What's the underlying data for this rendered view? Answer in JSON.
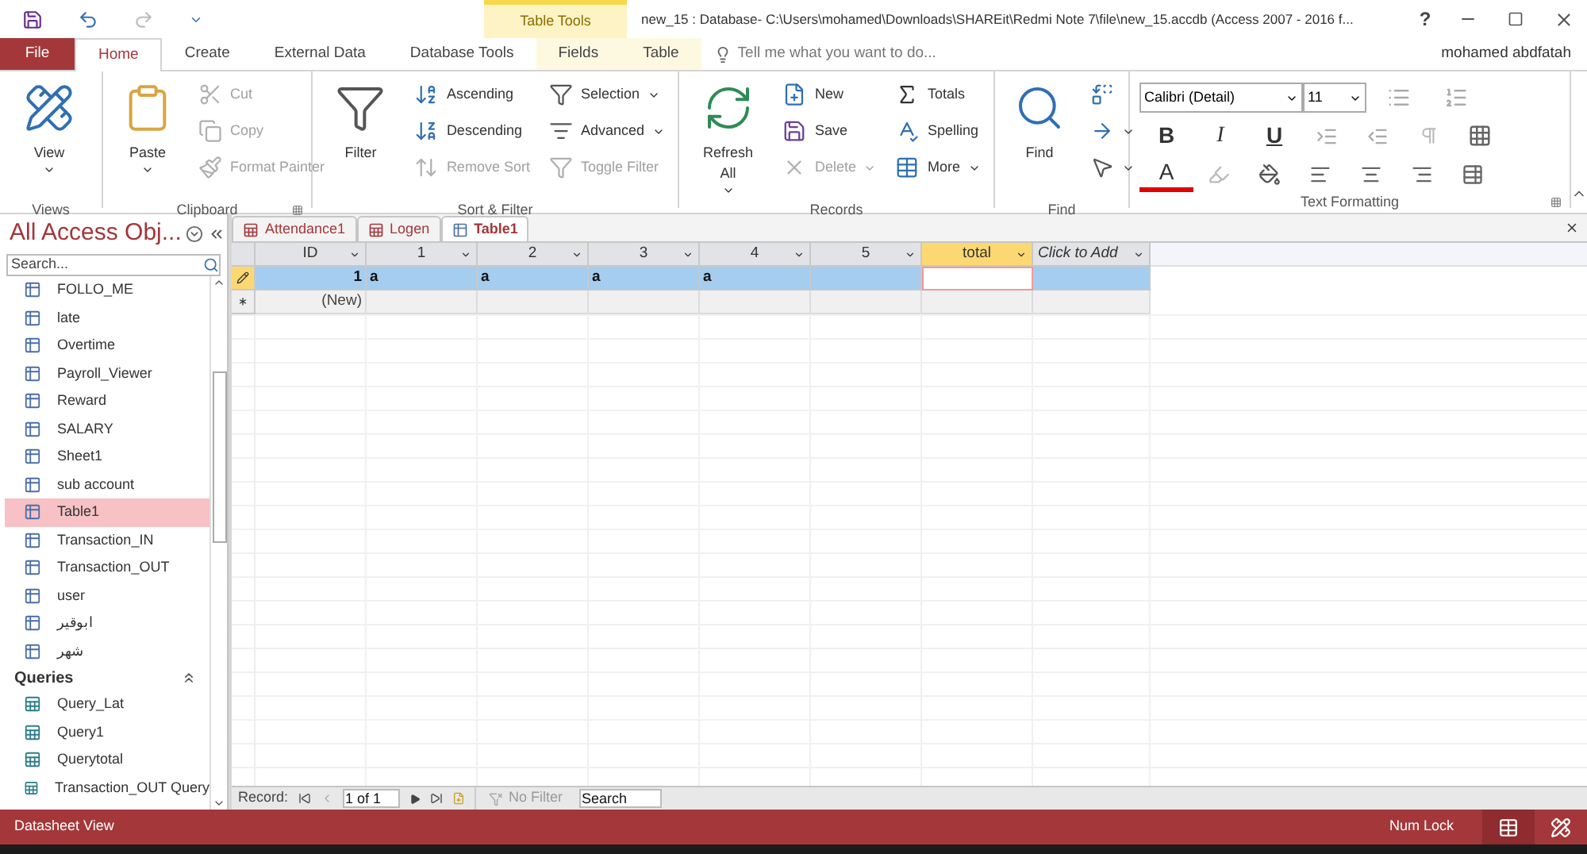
{
  "title_bar": {
    "contextual_group": "Table Tools",
    "title": "new_15 : Database- C:\\Users\\mohamed\\Downloads\\SHAREit\\Redmi Note 7\\file\\new_15.accdb (Access 2007 - 2016 f...",
    "help": "?"
  },
  "tabs": [
    {
      "label": "File",
      "kind": "file",
      "selected": false
    },
    {
      "label": "Home",
      "kind": "normal",
      "selected": true
    },
    {
      "label": "Create",
      "kind": "normal",
      "selected": false
    },
    {
      "label": "External Data",
      "kind": "normal",
      "selected": false
    },
    {
      "label": "Database Tools",
      "kind": "normal",
      "selected": false
    },
    {
      "label": "Fields",
      "kind": "contextual",
      "selected": false
    },
    {
      "label": "Table",
      "kind": "contextual",
      "selected": false
    }
  ],
  "tell_me": {
    "placeholder": "Tell me what you want to do..."
  },
  "user": "mohamed abdfatah",
  "ribbon_groups": [
    {
      "label": "Views",
      "launcher": false,
      "items": [
        {
          "label": "View",
          "kind": "large",
          "dropdown": true,
          "disabled": false
        }
      ]
    },
    {
      "label": "Clipboard",
      "launcher": true,
      "items": [
        {
          "label": "Paste",
          "kind": "large",
          "dropdown": true,
          "disabled": false
        },
        {
          "label": "Cut",
          "kind": "small",
          "dropdown": false,
          "disabled": true
        },
        {
          "label": "Copy",
          "kind": "small",
          "dropdown": false,
          "disabled": true
        },
        {
          "label": "Format Painter",
          "kind": "small",
          "dropdown": false,
          "disabled": true
        }
      ]
    },
    {
      "label": "Sort & Filter",
      "launcher": false,
      "items": [
        {
          "label": "Filter",
          "kind": "large",
          "dropdown": false,
          "disabled": false
        },
        {
          "label": "Ascending",
          "kind": "small",
          "dropdown": false,
          "disabled": false
        },
        {
          "label": "Descending",
          "kind": "small",
          "dropdown": false,
          "disabled": false
        },
        {
          "label": "Remove Sort",
          "kind": "small",
          "dropdown": false,
          "disabled": true
        },
        {
          "label": "Selection",
          "kind": "small",
          "dropdown": true,
          "disabled": false
        },
        {
          "label": "Advanced",
          "kind": "small",
          "dropdown": true,
          "disabled": false
        },
        {
          "label": "Toggle Filter",
          "kind": "small",
          "dropdown": false,
          "disabled": true
        }
      ]
    },
    {
      "label": "Records",
      "launcher": false,
      "items": [
        {
          "label": "Refresh All",
          "kind": "large",
          "dropdown": true,
          "disabled": false
        },
        {
          "label": "New",
          "kind": "small",
          "dropdown": false,
          "disabled": false
        },
        {
          "label": "Save",
          "kind": "small",
          "dropdown": false,
          "disabled": false
        },
        {
          "label": "Delete",
          "kind": "small",
          "dropdown": true,
          "disabled": true
        },
        {
          "label": "Totals",
          "kind": "small",
          "dropdown": false,
          "disabled": false
        },
        {
          "label": "Spelling",
          "kind": "small",
          "dropdown": false,
          "disabled": false
        },
        {
          "label": "More",
          "kind": "small",
          "dropdown": true,
          "disabled": false
        }
      ]
    },
    {
      "label": "Find",
      "launcher": false,
      "items": [
        {
          "label": "Find",
          "kind": "large",
          "dropdown": false,
          "disabled": false
        },
        {
          "kind": "small",
          "dropdown": false,
          "disabled": false
        },
        {
          "kind": "small",
          "dropdown": true,
          "disabled": false
        },
        {
          "kind": "small",
          "dropdown": true,
          "disabled": false
        }
      ]
    }
  ],
  "text_formatting": {
    "label": "Text Formatting",
    "font": "Calibri (Detail)",
    "size": "11",
    "styles": [
      "B",
      "I",
      "U"
    ],
    "font_color": "A",
    "launcher": true
  },
  "nav_pane": {
    "title": "All Access Obj...",
    "search": {
      "placeholder": "Search..."
    },
    "groups": [
      {
        "items": [
          {
            "label": "FOLLO_ME",
            "kind": "table",
            "selected": false
          },
          {
            "label": "late",
            "kind": "table",
            "selected": false
          },
          {
            "label": "Overtime",
            "kind": "table",
            "selected": false
          },
          {
            "label": "Payroll_Viewer",
            "kind": "table",
            "selected": false
          },
          {
            "label": "Reward",
            "kind": "table",
            "selected": false
          },
          {
            "label": "SALARY",
            "kind": "table",
            "selected": false
          },
          {
            "label": "Sheet1",
            "kind": "table",
            "selected": false
          },
          {
            "label": "sub account",
            "kind": "table",
            "selected": false
          },
          {
            "label": "Table1",
            "kind": "table",
            "selected": true
          },
          {
            "label": "Transaction_IN",
            "kind": "table",
            "selected": false
          },
          {
            "label": "Transaction_OUT",
            "kind": "table",
            "selected": false
          },
          {
            "label": "user",
            "kind": "table",
            "selected": false
          },
          {
            "label": "ابوقير",
            "kind": "table",
            "selected": false
          },
          {
            "label": "شهر",
            "kind": "table",
            "selected": false
          }
        ]
      },
      {
        "title": "Queries",
        "expanded": true,
        "items": [
          {
            "label": "Query_Lat",
            "kind": "query",
            "selected": false
          },
          {
            "label": "Query1",
            "kind": "query",
            "selected": false
          },
          {
            "label": "Querytotal",
            "kind": "query",
            "selected": false
          },
          {
            "label": "Transaction_OUT Query",
            "kind": "query",
            "selected": false
          }
        ]
      }
    ]
  },
  "document_tabs": [
    {
      "label": "Attendance1",
      "kind": "query",
      "selected": false
    },
    {
      "label": "Logen",
      "kind": "query",
      "selected": false
    },
    {
      "label": "Table1",
      "kind": "table",
      "selected": true
    }
  ],
  "datasheet": {
    "columns": [
      {
        "label": "ID",
        "kind": "field",
        "selected": false
      },
      {
        "label": "1",
        "kind": "field",
        "selected": false
      },
      {
        "label": "2",
        "kind": "field",
        "selected": false
      },
      {
        "label": "3",
        "kind": "field",
        "selected": false
      },
      {
        "label": "4",
        "kind": "field",
        "selected": false
      },
      {
        "label": "5",
        "kind": "field",
        "selected": false
      },
      {
        "label": "total",
        "kind": "field",
        "selected": true
      },
      {
        "label": "Click to Add",
        "kind": "add",
        "selected": false
      }
    ],
    "rows": [
      {
        "kind": "editing",
        "selected": true,
        "cells": [
          "1",
          "a",
          "a",
          "a",
          "a",
          "",
          "",
          ""
        ]
      },
      {
        "kind": "new",
        "selected": false,
        "cells": [
          "(New)",
          "",
          "",
          "",
          "",
          "",
          "",
          ""
        ]
      }
    ],
    "record_nav": {
      "label": "Record:",
      "position": "1 of 1",
      "filter": "No Filter",
      "search": {
        "placeholder": "Search"
      }
    }
  },
  "status_bar": {
    "text": "Datasheet View",
    "indicator": "Num Lock",
    "views": [
      {
        "selected": true
      },
      {
        "selected": false
      }
    ]
  }
}
